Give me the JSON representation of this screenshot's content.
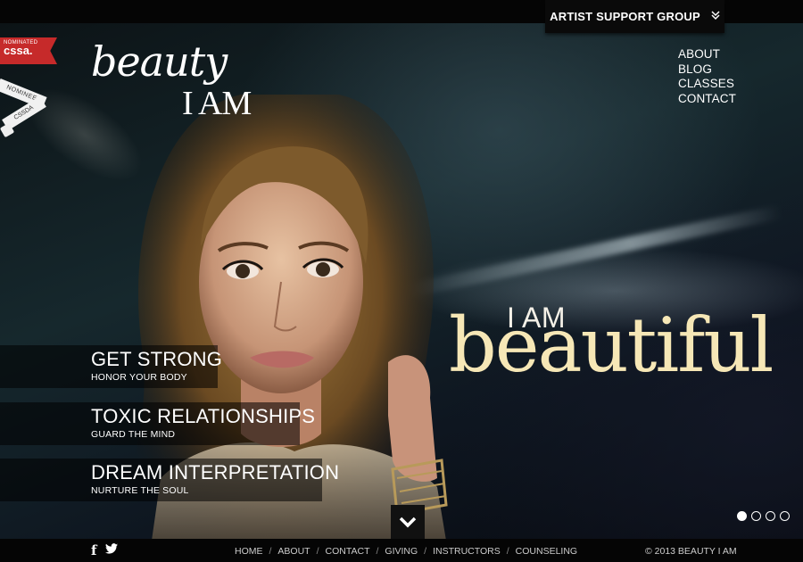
{
  "support_tab": {
    "label": "ARTIST SUPPORT GROUP",
    "chevron_icon": "double-chevron-down-icon"
  },
  "badges": {
    "cssa_small": "NOMINATED",
    "cssa_big": "cssa.",
    "nominee": "NOMINEE",
    "cssda": "CSSDA"
  },
  "logo": {
    "script": "beauty",
    "sub": "I AM"
  },
  "nav": [
    "ABOUT",
    "BLOG",
    "CLASSES",
    "CONTACT"
  ],
  "headline": {
    "small": "I AM",
    "big": "beautiful"
  },
  "features": [
    {
      "title": "GET STRONG",
      "subtitle": "HONOR YOUR BODY"
    },
    {
      "title": "TOXIC RELATIONSHIPS",
      "subtitle": "GUARD THE MIND"
    },
    {
      "title": "DREAM INTERPRETATION",
      "subtitle": "NURTURE THE SOUL"
    }
  ],
  "slider": {
    "count": 4,
    "active": 1
  },
  "footer": {
    "social": {
      "facebook": "f",
      "twitter": "🐦"
    },
    "links": [
      "HOME",
      "ABOUT",
      "CONTACT",
      "GIVING",
      "INSTRUCTORS",
      "COUNSELING"
    ],
    "copyright": "© 2013 BEAUTY I AM"
  },
  "colors": {
    "headline_gold": "#f6e7b6",
    "badge_red": "#c62a2a",
    "bar": "#050505"
  }
}
